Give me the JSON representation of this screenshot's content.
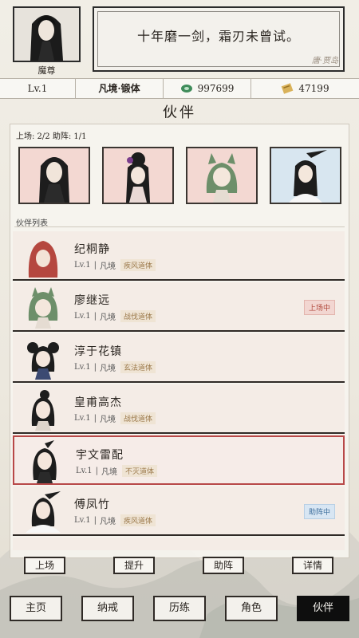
{
  "header": {
    "player_title": "魔尊",
    "quote": "十年磨一剑，霜刃未曾试。",
    "quote_source": "唐·贾岛"
  },
  "stats": {
    "level": "Lv.1",
    "realm": "凡境·锻体",
    "jade": "997699",
    "scroll": "47199"
  },
  "page_title": "伙伴",
  "deploy_status": "上场: 2/2  助阵: 1/1",
  "list_label": "伙伴列表",
  "partners": [
    {
      "name": "纪桐静",
      "level": "Lv.1",
      "realm": "凡境",
      "trait": "疾风道体",
      "status": ""
    },
    {
      "name": "廖继远",
      "level": "Lv.1",
      "realm": "凡境",
      "trait": "战伐道体",
      "status": "上场中"
    },
    {
      "name": "淳于花镇",
      "level": "Lv.1",
      "realm": "凡境",
      "trait": "玄法道体",
      "status": ""
    },
    {
      "name": "皇甫高杰",
      "level": "Lv.1",
      "realm": "凡境",
      "trait": "战伐道体",
      "status": ""
    },
    {
      "name": "宇文雷配",
      "level": "Lv.1",
      "realm": "凡境",
      "trait": "不灭道体",
      "status": ""
    },
    {
      "name": "傅凤竹",
      "level": "Lv.1",
      "realm": "凡境",
      "trait": "疾风道体",
      "status": "助阵中"
    }
  ],
  "actions": {
    "deploy": "上场",
    "upgrade": "提升",
    "assist": "助阵",
    "details": "详情"
  },
  "nav": {
    "home": "主页",
    "ring": "纳戒",
    "journey": "历练",
    "role": "角色",
    "partner": "伙伴"
  },
  "colors": {
    "selected_border": "#b84848",
    "onfield": "#b0473a",
    "assist": "#3f6f9c"
  }
}
